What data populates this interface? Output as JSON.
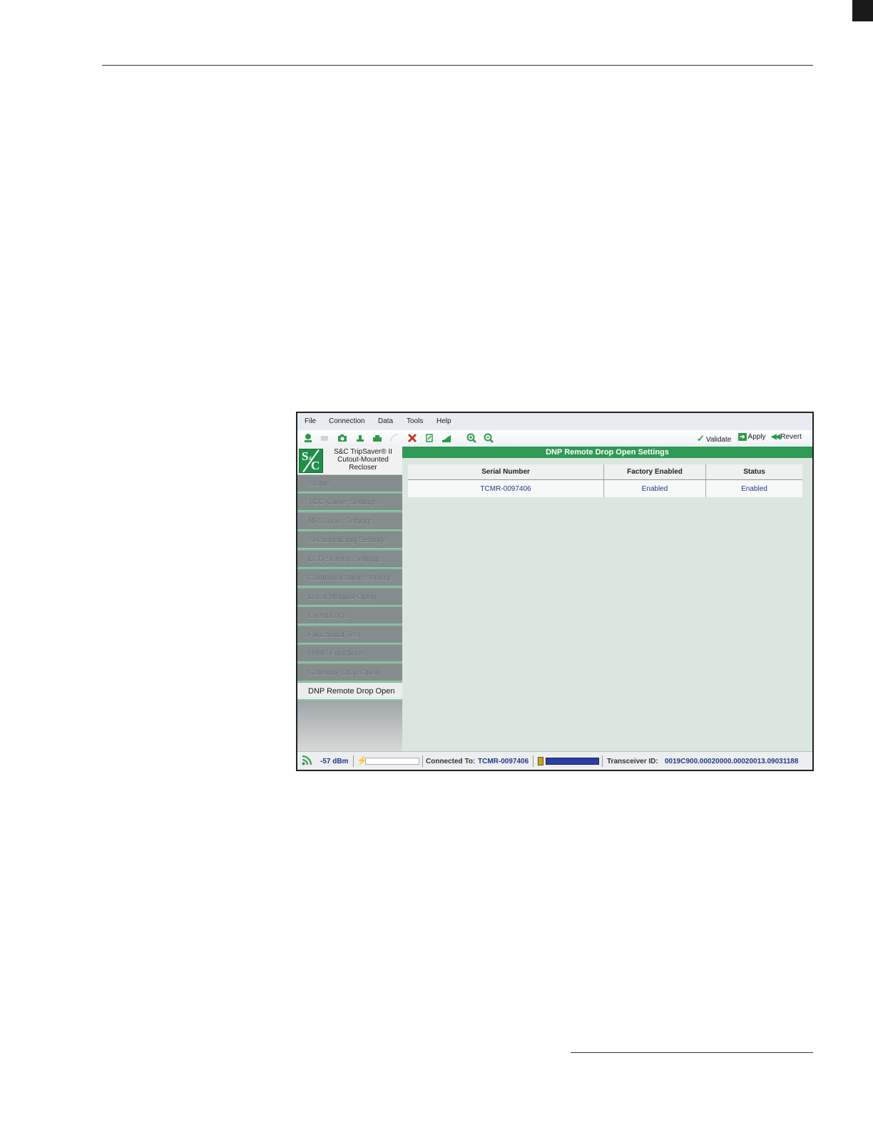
{
  "menubar": {
    "items": [
      "File",
      "Connection",
      "Data",
      "Tools",
      "Help"
    ]
  },
  "toolbar": {
    "icons": [
      "connect-icon",
      "disconnect-icon",
      "camera-icon",
      "upload-icon",
      "print-icon",
      "signal-icon",
      "delete-icon",
      "edit-icon",
      "chart-icon",
      "zoom-in-icon",
      "zoom-out-icon"
    ],
    "validate_label": "Validate",
    "apply_label": "Apply",
    "revert_label": "Revert"
  },
  "sidebar": {
    "brand_line1": "S&C TripSaver® II",
    "brand_line2": "Cutout-Mounted",
    "brand_line3": "Recloser",
    "items": [
      {
        "label": "Status"
      },
      {
        "label": "TCC Curve Settings"
      },
      {
        "label": "NR Curve Settings"
      },
      {
        "label": "Sectionalizing Settings"
      },
      {
        "label": "LCD Screen Settings"
      },
      {
        "label": "Communication Settings"
      },
      {
        "label": "Local Manual Open"
      },
      {
        "label": "Event Logs"
      },
      {
        "label": "Functional Test"
      },
      {
        "label": "R-NR Functions"
      },
      {
        "label": "Gateway Drop Open"
      },
      {
        "label": "DNP Remote Drop Open"
      }
    ],
    "active_index": 11
  },
  "main": {
    "title": "DNP Remote Drop Open Settings",
    "columns": [
      "Serial Number",
      "Factory Enabled",
      "Status"
    ],
    "rows": [
      {
        "serial": "TCMR-0097406",
        "factory_enabled": "Enabled",
        "status": "Enabled"
      }
    ]
  },
  "statusbar": {
    "signal": "-57 dBm",
    "connected_label": "Connected To:",
    "connected_value": "TCMR-0097406",
    "battery_level": 1.0,
    "transceiver_label": "Transceiver ID:",
    "transceiver_value": "0019C900.00020000.00020013.09031188"
  },
  "colors": {
    "accent_green": "#2f9a55",
    "link_blue": "#1f3a8a"
  }
}
